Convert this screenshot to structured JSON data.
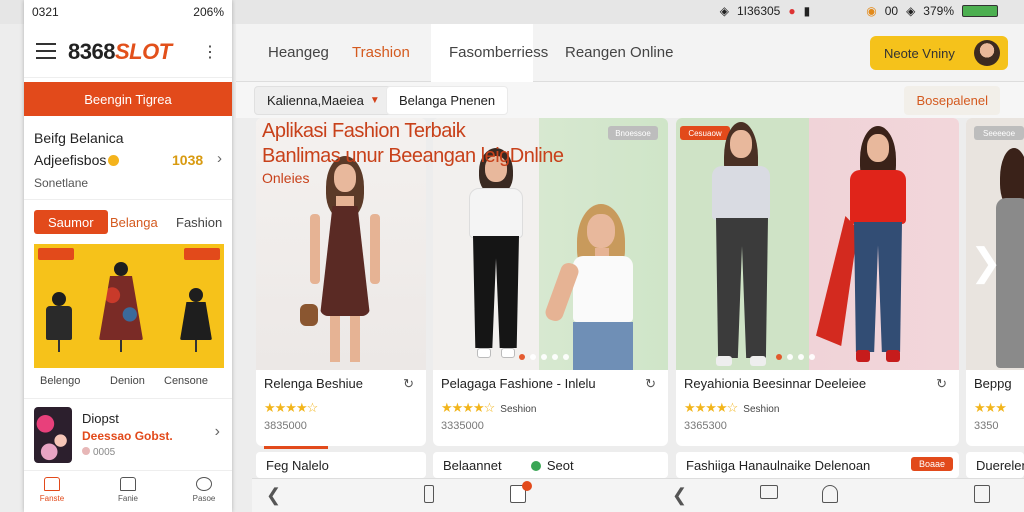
{
  "status_bar": {
    "right_time": "1I36305",
    "battery": "379%",
    "signal": "00"
  },
  "phone": {
    "status_time": "0321",
    "status_batt": "206%",
    "logo_num": "8368",
    "logo_slot": "SLOT",
    "banner": "Beengin Tigrea",
    "info": {
      "line1": "Beifg Belanica",
      "line2": "Adjeefisbos",
      "points": "1038",
      "line3": "Sonetlane"
    },
    "tabs": [
      "Saumor",
      "Belanga",
      "Fashion"
    ],
    "cats": [
      "Belengo",
      "Denion",
      "Censone"
    ],
    "product": {
      "name": "Diopst",
      "price": "Deessao Gobst.",
      "qty": "0005"
    },
    "bottom": [
      "Fanste",
      "Fanie",
      "Pasoe"
    ]
  },
  "nav": {
    "items": [
      "Heangeg",
      "Trashion",
      "Fasomberriess",
      "Reangen Online"
    ],
    "active_index": 1,
    "profile": "Neote Vniny"
  },
  "filters": {
    "dropdown": "Kalienna,Maeiea",
    "chip2": "Belanga Pnenen",
    "chip3": "Bosepalenel"
  },
  "headline": {
    "line1": "Aplikasi Fashion Terbaik",
    "line2": "Banlimas unur Beeangan leigDnline",
    "line3": "Onleies"
  },
  "cards": [
    {
      "title": "Relenga Beshiue",
      "rating_label": "",
      "price": "3835000",
      "tag": ""
    },
    {
      "title": "Pelagaga Fashione - Inlelu",
      "rating_label": "Seshion",
      "price": "3335000",
      "tag": "Bnoessoe"
    },
    {
      "title": "Reyahionia Beesinnar Deeleiee",
      "rating_label": "Seshion",
      "price": "3365300",
      "tag": "Cesuaow"
    },
    {
      "title": "Beppg",
      "rating_label": "",
      "price": "3350",
      "tag": "Seeeeoe"
    }
  ],
  "bottom_row": [
    "Feg Nalelo",
    "Belaannet",
    "Seot",
    "Fashiiga Hanaulnaike Delenoan",
    "Boaae",
    "Duerelen"
  ],
  "colors": {
    "accent": "#e24a1b",
    "yellow": "#f6c21a",
    "card_bg": "#ffffff"
  }
}
